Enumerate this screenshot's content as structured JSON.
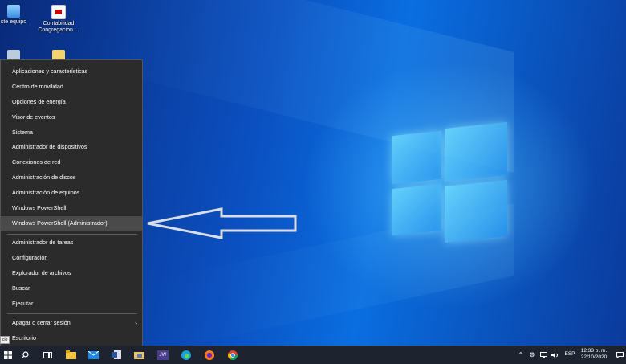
{
  "desktop": {
    "icons": [
      {
        "label": "Este equipo",
        "shown": "ste equipo"
      },
      {
        "label": "Contabilidad Congregacion ...",
        "shown_1": "Contabilidad",
        "shown_2": "Congregacion ..."
      }
    ]
  },
  "winx_menu": {
    "items": [
      "Aplicaciones y características",
      "Centro de movilidad",
      "Opciones de energía",
      "Visor de eventos",
      "Sistema",
      "Administrador de dispositivos",
      "Conexiones de red",
      "Administración de discos",
      "Administración de equipos",
      "Windows PowerShell",
      "Windows PowerShell (Administrador)",
      "Administrador de tareas",
      "Configuración",
      "Explorador de archivos",
      "Buscar",
      "Ejecutar",
      "Apagar o cerrar sesión",
      "Escritorio"
    ],
    "highlighted": "Windows PowerShell (Administrador)"
  },
  "tooltip": {
    "text": "cio"
  },
  "taskbar": {
    "pinned": [
      "start-icon",
      "search-icon",
      "task-view-icon",
      "file-explorer-icon",
      "mail-icon",
      "word-icon",
      "folder-icon",
      "jw-icon",
      "edge-icon",
      "firefox-icon",
      "chrome-icon"
    ],
    "jw_label": "JW",
    "tray": {
      "language": "ESP",
      "time": "12:33 p. m.",
      "date": "22/10/2020"
    }
  },
  "colors": {
    "menu_bg": "#2b2b2b",
    "menu_highlight": "#4a4a4a",
    "taskbar_bg": "#1d2430",
    "arrow": "#d8dde4"
  }
}
